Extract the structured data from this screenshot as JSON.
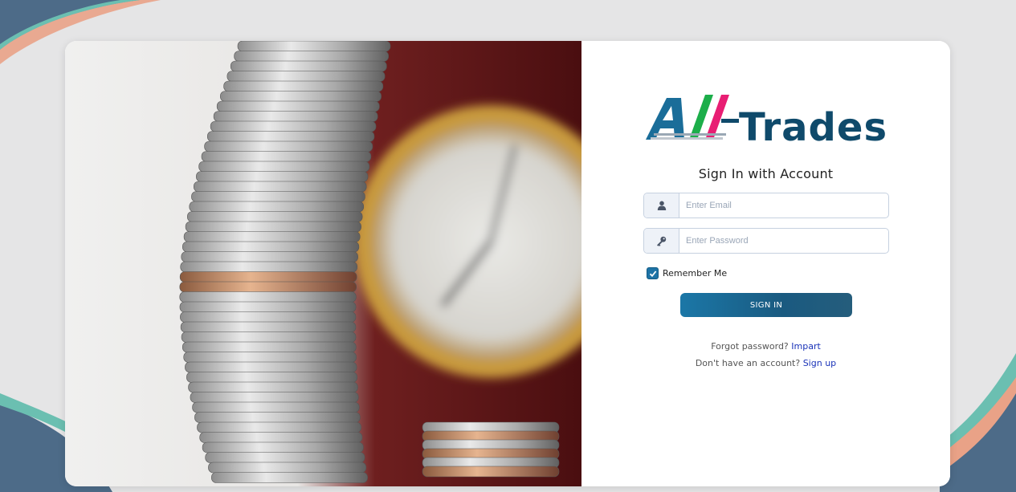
{
  "brand": {
    "logo_text_prefix": "All",
    "logo_text_suffix": "Trades",
    "logo_colors": [
      "#1a6d99",
      "#1cae4a",
      "#e81e73",
      "#0f4a6b"
    ]
  },
  "login": {
    "heading": "Sign In with Account",
    "email": {
      "placeholder": "Enter Email",
      "value": "",
      "icon": "user-icon"
    },
    "password": {
      "placeholder": "Enter Password",
      "value": "",
      "icon": "key-icon"
    },
    "remember_label": "Remember Me",
    "remember_checked": true,
    "submit_label": "SIGN IN",
    "forgot_text": "Forgot password?",
    "forgot_link": "Impart",
    "signup_text": "Don't have an account?",
    "signup_link": "Sign up"
  },
  "theme": {
    "accent": "#1b6f9e",
    "link": "#1a33b8",
    "background": "#e5e5e6"
  }
}
